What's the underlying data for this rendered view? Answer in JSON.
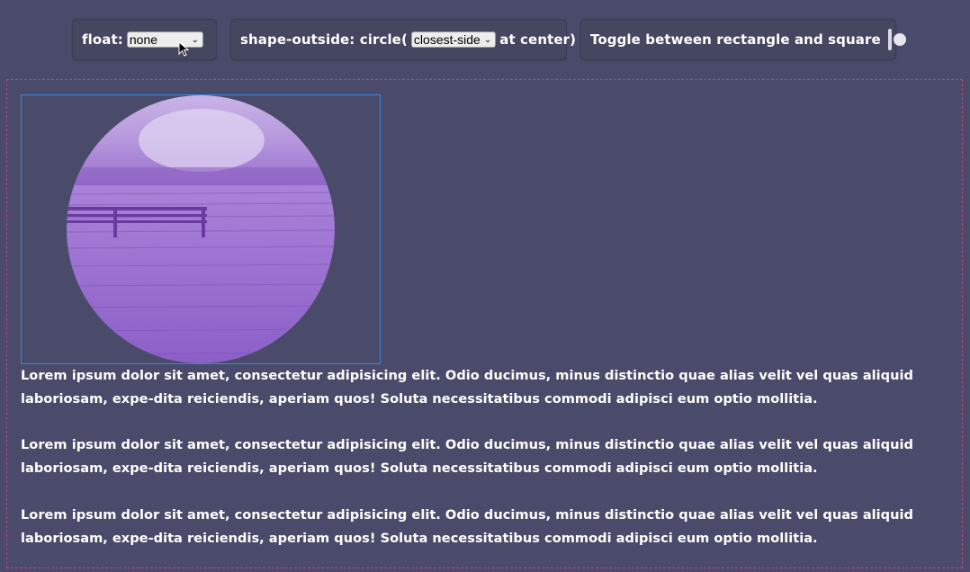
{
  "controls": {
    "float_label": "float:",
    "float_value": "none",
    "shape_label_prefix": "shape-outside: circle(",
    "shape_value": "closest-side",
    "shape_label_suffix": "at center)",
    "toggle_label": "Toggle between rectangle and square",
    "toggle_on": false
  },
  "content": {
    "image_alt": "bench on a pier by the water",
    "paragraphs": [
      "Lorem ipsum dolor sit amet, consectetur adipisicing elit. Odio ducimus, minus distinctio quae alias velit vel quas aliquid laboriosam, expe-dita reiciendis, aperiam quos! Soluta necessitatibus commodi adipisci eum optio mollitia.",
      "Lorem ipsum dolor sit amet, consectetur adipisicing elit. Odio ducimus, minus distinctio quae alias velit vel quas aliquid laboriosam, expe-dita reiciendis, aperiam quos! Soluta necessitatibus commodi adipisci eum optio mollitia.",
      "Lorem ipsum dolor sit amet, consectetur adipisicing elit. Odio ducimus, minus distinctio quae alias velit vel quas aliquid laboriosam, expe-dita reiciendis, aperiam quos! Soluta necessitatibus commodi adipisci eum optio mollitia."
    ]
  },
  "colors": {
    "background": "#4a4b6a",
    "dashed_border": "#b8457d",
    "float_outline": "#3d86e0",
    "image_tint": "#a77bd6"
  }
}
